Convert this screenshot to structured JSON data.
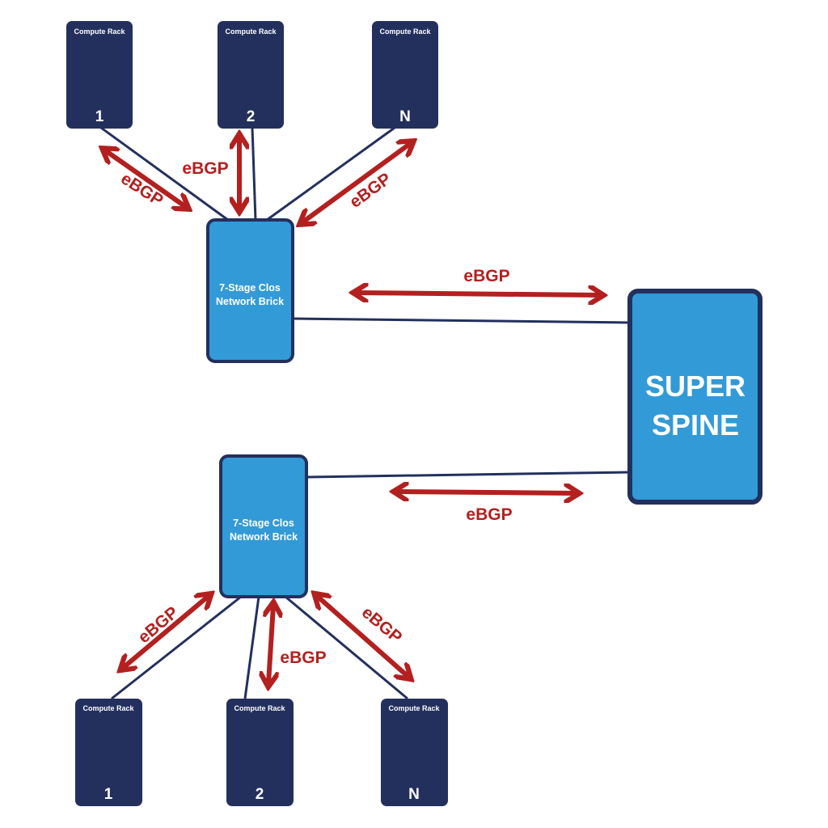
{
  "colors": {
    "rack_fill": "#23305e",
    "brick_fill": "#329ad7",
    "outline": "#23305e",
    "link": "#23305e",
    "arrow": "#b3201f",
    "label_text": "#ffffff"
  },
  "super_spine": {
    "line1": "SUPER",
    "line2": "SPINE"
  },
  "top_brick": {
    "line1": "7-Stage Clos",
    "line2": "Network Brick"
  },
  "bottom_brick": {
    "line1": "7-Stage Clos",
    "line2": "Network Brick"
  },
  "top_racks": [
    {
      "title": "Compute Rack",
      "number": "1"
    },
    {
      "title": "Compute Rack",
      "number": "2"
    },
    {
      "title": "Compute Rack",
      "number": "N"
    }
  ],
  "bottom_racks": [
    {
      "title": "Compute Rack",
      "number": "1"
    },
    {
      "title": "Compute Rack",
      "number": "2"
    },
    {
      "title": "Compute Rack",
      "number": "N"
    }
  ],
  "protocol_labels": {
    "top_rack1": "eBGP",
    "top_rack2": "eBGP",
    "top_rackN": "eBGP",
    "top_spine": "eBGP",
    "bottom_spine": "eBGP",
    "bottom_rack1": "eBGP",
    "bottom_rack2": "eBGP",
    "bottom_rackN": "eBGP"
  }
}
